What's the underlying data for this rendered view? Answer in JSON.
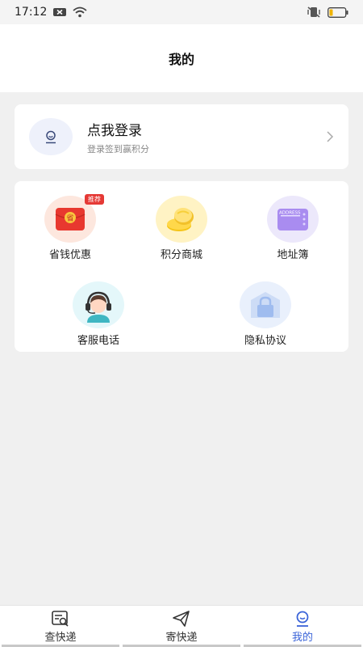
{
  "status_bar": {
    "time": "17:12"
  },
  "header": {
    "title": "我的"
  },
  "login": {
    "title": "点我登录",
    "subtitle": "登录签到赢积分"
  },
  "grid": [
    {
      "label": "省钱优惠",
      "badge": "推荐",
      "icon": "red-envelope-icon"
    },
    {
      "label": "积分商城",
      "icon": "coins-icon"
    },
    {
      "label": "地址簿",
      "icon": "address-book-icon",
      "icon_text": "ADDRESS"
    },
    {
      "label": "客服电话",
      "icon": "customer-service-icon"
    },
    {
      "label": "隐私协议",
      "icon": "lock-icon"
    }
  ],
  "bottom_nav": [
    {
      "label": "查快递",
      "icon": "search-package-icon"
    },
    {
      "label": "寄快递",
      "icon": "send-icon"
    },
    {
      "label": "我的",
      "icon": "profile-icon",
      "active": true
    }
  ],
  "colors": {
    "accent": "#3a63d8",
    "badge": "#e53935"
  }
}
